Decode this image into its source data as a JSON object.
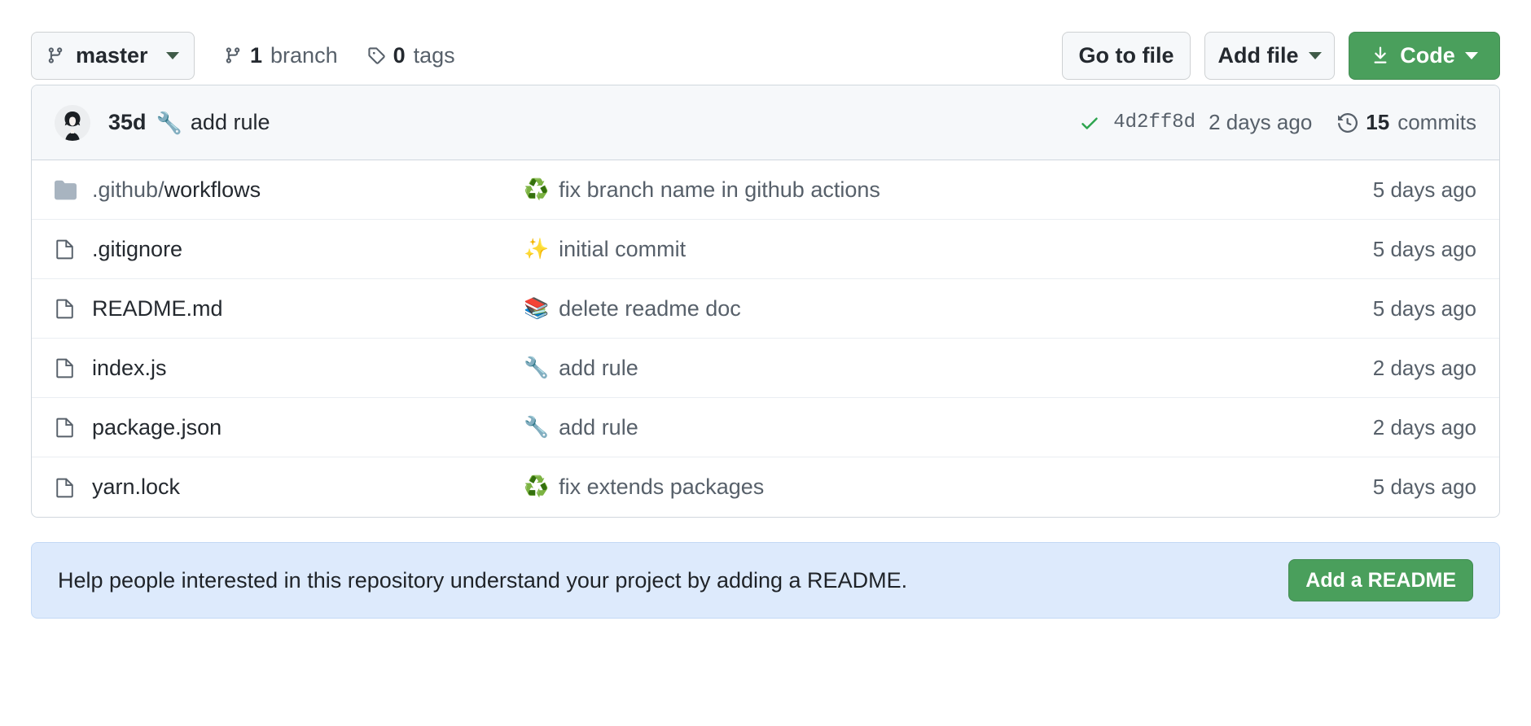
{
  "toolbar": {
    "branch_button": {
      "label": "master",
      "icon": "git-branch-icon",
      "caret": "chevron-down-icon"
    },
    "branch_count": {
      "count": "1",
      "label": "branch",
      "icon": "git-branch-icon"
    },
    "tag_count": {
      "count": "0",
      "label": "tags",
      "icon": "tag-icon"
    },
    "go_to_file": "Go to file",
    "add_file": "Add file",
    "code": "Code"
  },
  "latest_commit": {
    "author": "35d",
    "emoji": "🔧",
    "message": "add rule",
    "status_icon": "check-icon",
    "sha": "4d2ff8d",
    "date": "2 days ago",
    "history_icon": "history-icon",
    "commits_count": "15",
    "commits_label": "commits"
  },
  "files": [
    {
      "type": "directory",
      "name_dim": ".github/",
      "name_strong": "workflows",
      "emoji": "♻️",
      "message": "fix branch name in github actions",
      "date": "5 days ago"
    },
    {
      "type": "file",
      "name_dim": "",
      "name_strong": ".gitignore",
      "emoji": "✨",
      "message": "initial commit",
      "date": "5 days ago"
    },
    {
      "type": "file",
      "name_dim": "",
      "name_strong": "README.md",
      "emoji": "📚",
      "message": "delete readme doc",
      "date": "5 days ago"
    },
    {
      "type": "file",
      "name_dim": "",
      "name_strong": "index.js",
      "emoji": "🔧",
      "message": "add rule",
      "date": "2 days ago"
    },
    {
      "type": "file",
      "name_dim": "",
      "name_strong": "package.json",
      "emoji": "🔧",
      "message": "add rule",
      "date": "2 days ago"
    },
    {
      "type": "file",
      "name_dim": "",
      "name_strong": "yarn.lock",
      "emoji": "♻️",
      "message": "fix extends packages",
      "date": "5 days ago"
    }
  ],
  "readme_banner": {
    "text": "Help people interested in this repository understand your project by adding a README.",
    "button_label": "Add a README"
  },
  "colors": {
    "green_button": "#4a9f5c",
    "banner_background": "#ddeafc",
    "panel_background": "#f6f8fa",
    "border": "#d0d7de",
    "text_primary": "#24292f",
    "text_muted": "#57606a",
    "folder_icon": "#a8b4c0",
    "check_green": "#2da44e"
  }
}
